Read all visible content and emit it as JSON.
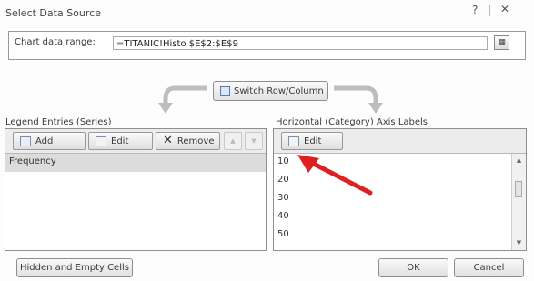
{
  "window": {
    "title": "Select Data Source",
    "help_glyph": "?",
    "close_glyph": "✕"
  },
  "chart_range": {
    "label": "Chart data range:",
    "value": "=TITANIC!Histo $E$2:$E$9"
  },
  "switch_button": {
    "label": "Switch Row/Column"
  },
  "legend": {
    "label": "Legend Entries (Series)",
    "add_label": "Add",
    "edit_label": "Edit",
    "remove_label": "Remove",
    "up_glyph": "▲",
    "down_glyph": "▼",
    "series": [
      "Frequency"
    ]
  },
  "axis": {
    "label": "Horizontal (Category) Axis Labels",
    "edit_label": "Edit",
    "values": [
      "10",
      "20",
      "30",
      "40",
      "50"
    ]
  },
  "footer": {
    "hidden_cells_label": "Hidden and Empty Cells",
    "ok_label": "OK",
    "cancel_label": "Cancel"
  },
  "annotation_color": "#e02020"
}
